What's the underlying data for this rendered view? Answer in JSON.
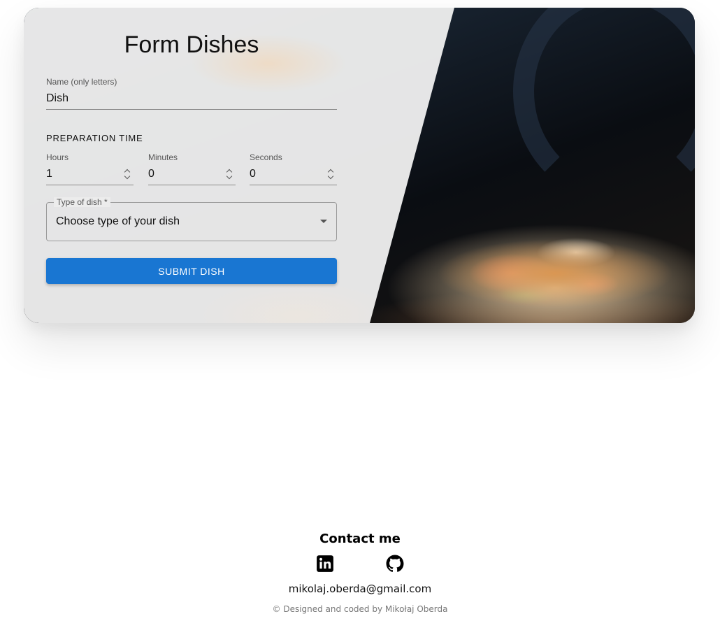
{
  "form": {
    "title": "Form Dishes",
    "name": {
      "label": "Name (only letters)",
      "value": "Dish"
    },
    "preparation_time": {
      "title": "PREPARATION TIME",
      "hours": {
        "label": "Hours",
        "value": "1"
      },
      "minutes": {
        "label": "Minutes",
        "value": "0"
      },
      "seconds": {
        "label": "Seconds",
        "value": "0"
      }
    },
    "type_of_dish": {
      "label": "Type of dish *",
      "value": "Choose type of your dish"
    },
    "submit_label": "SUBMIT DISH"
  },
  "footer": {
    "contact_title": "Contact me",
    "icons": [
      "linkedin-icon",
      "github-icon"
    ],
    "email": "mikolaj.oberda@gmail.com",
    "copyright": "© Designed and coded by Mikołaj Oberda"
  },
  "colors": {
    "primary": "#1976d2",
    "panel": "#ececec"
  }
}
